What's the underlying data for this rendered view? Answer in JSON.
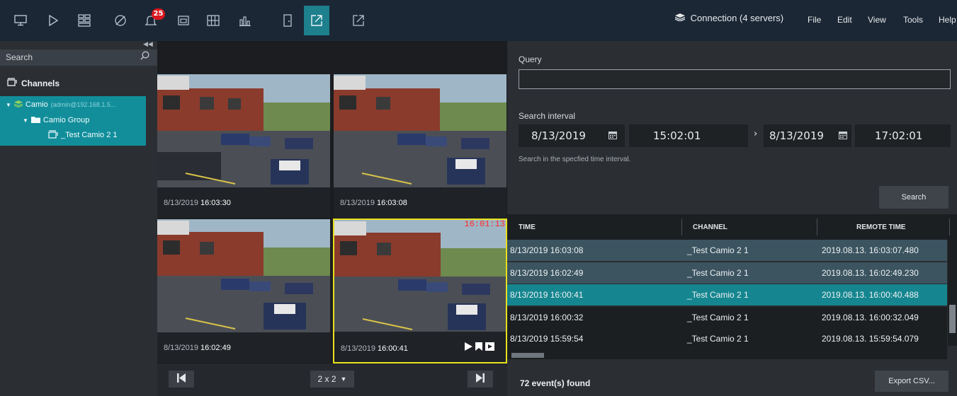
{
  "toolbar": {
    "notification_count": "25",
    "connection_label": "Connection (4 servers)",
    "menu": [
      "File",
      "Edit",
      "View",
      "Tools",
      "Help"
    ],
    "icons": [
      "monitor-icon",
      "play-icon",
      "layout-grid-icon",
      "camera-off-icon",
      "bell-icon",
      "folder-icon",
      "grid-icon",
      "chart-icon",
      "door-icon",
      "export-window-icon",
      "export-window-outline-icon"
    ],
    "accent": "#1e7f8d"
  },
  "left_panel": {
    "search_placeholder": "Search",
    "channels_title": "Channels",
    "tree": {
      "server_name": "Camio",
      "server_detail": "(admin@192.168.1.5...",
      "group_name": "Camio Group",
      "channel_name": "_Test Camio 2 1"
    }
  },
  "videos": {
    "tiles": [
      {
        "date": "8/13/2019",
        "time": "16:03:30"
      },
      {
        "date": "8/13/2019",
        "time": "16:03:08"
      },
      {
        "date": "8/13/2019",
        "time": "16:02:49"
      },
      {
        "date": "8/13/2019",
        "time": "16:00:41",
        "overlay_time": "16:01:13"
      }
    ],
    "layout_label": "2 x 2"
  },
  "search_panel": {
    "query_label": "Query",
    "query_value": "",
    "interval_label": "Search interval",
    "start_date": "8/13/2019",
    "start_time": "15:02:01",
    "end_date": "8/13/2019",
    "end_time": "17:02:01",
    "interval_hint": "Search in the specfied time interval.",
    "search_button": "Search",
    "columns": [
      "TIME",
      "CHANNEL",
      "REMOTE TIME"
    ],
    "rows": [
      {
        "time": "8/13/2019 16:03:08",
        "channel": "_Test Camio 2 1",
        "remote": "2019.08.13. 16:03:07.480"
      },
      {
        "time": "8/13/2019 16:02:49",
        "channel": "_Test Camio 2 1",
        "remote": "2019.08.13. 16:02:49.230"
      },
      {
        "time": "8/13/2019 16:00:41",
        "channel": "_Test Camio 2 1",
        "remote": "2019.08.13. 16:00:40.488"
      },
      {
        "time": "8/13/2019 16:00:32",
        "channel": "_Test Camio 2 1",
        "remote": "2019.08.13. 16:00:32.049"
      },
      {
        "time": "8/13/2019 15:59:54",
        "channel": "_Test Camio 2 1",
        "remote": "2019.08.13. 15:59:54.079"
      }
    ],
    "events_found": "72 event(s) found",
    "export_button": "Export CSV..."
  }
}
